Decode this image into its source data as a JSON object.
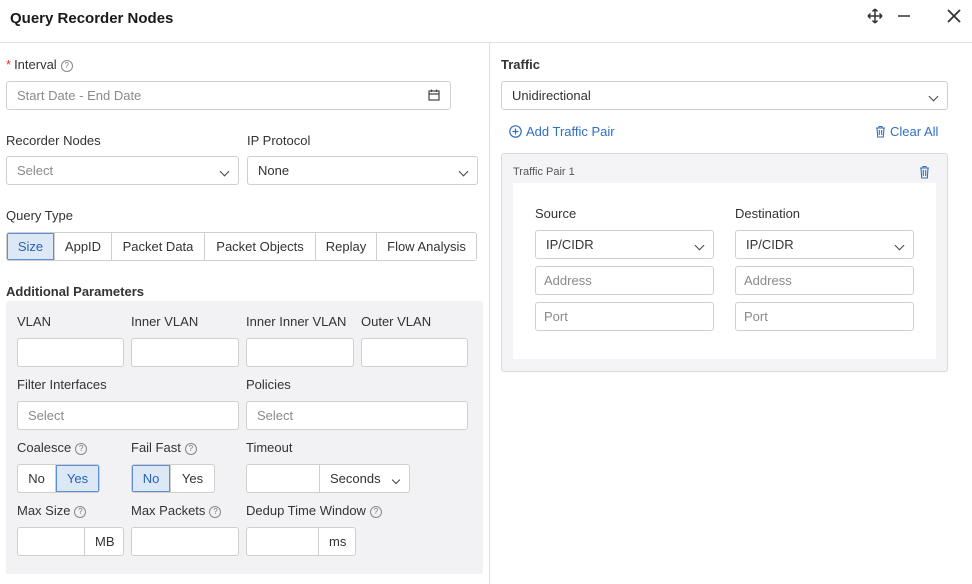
{
  "header": {
    "title": "Query Recorder Nodes"
  },
  "left": {
    "interval": {
      "label": "Interval",
      "placeholder": "Start Date - End Date"
    },
    "recorder_nodes": {
      "label": "Recorder Nodes",
      "value": "Select"
    },
    "ip_protocol": {
      "label": "IP Protocol",
      "value": "None"
    },
    "query_type": {
      "label": "Query Type",
      "options": [
        "Size",
        "AppID",
        "Packet Data",
        "Packet Objects",
        "Replay",
        "Flow Analysis"
      ],
      "selected": "Size"
    },
    "additional_parameters": {
      "label": "Additional Parameters",
      "vlan": {
        "label": "VLAN",
        "value": ""
      },
      "inner_vlan": {
        "label": "Inner VLAN",
        "value": ""
      },
      "inner_inner_vlan": {
        "label": "Inner Inner VLAN",
        "value": ""
      },
      "outer_vlan": {
        "label": "Outer VLAN",
        "value": ""
      },
      "filter_interfaces": {
        "label": "Filter Interfaces",
        "value": "Select"
      },
      "policies": {
        "label": "Policies",
        "value": "Select"
      },
      "coalesce": {
        "label": "Coalesce",
        "options": [
          "No",
          "Yes"
        ],
        "selected": "Yes"
      },
      "fail_fast": {
        "label": "Fail Fast",
        "options": [
          "No",
          "Yes"
        ],
        "selected": "No"
      },
      "timeout": {
        "label": "Timeout",
        "value": "",
        "unit": "Seconds"
      },
      "max_size": {
        "label": "Max Size",
        "value": "",
        "unit": "MB"
      },
      "max_packets": {
        "label": "Max Packets",
        "value": ""
      },
      "dedup_time_window": {
        "label": "Dedup Time Window",
        "value": "",
        "unit": "ms"
      }
    }
  },
  "right": {
    "traffic": {
      "label": "Traffic",
      "value": "Unidirectional"
    },
    "add_traffic_pair": "Add Traffic Pair",
    "clear_all": "Clear All",
    "traffic_pair": {
      "title": "Traffic Pair 1",
      "source": {
        "label": "Source",
        "type": "IP/CIDR",
        "address_placeholder": "Address",
        "port_placeholder": "Port"
      },
      "destination": {
        "label": "Destination",
        "type": "IP/CIDR",
        "address_placeholder": "Address",
        "port_placeholder": "Port"
      }
    }
  },
  "colors": {
    "accent": "#2f6fc4",
    "selected_bg": "#dde8f7",
    "required": "#e0301e"
  }
}
